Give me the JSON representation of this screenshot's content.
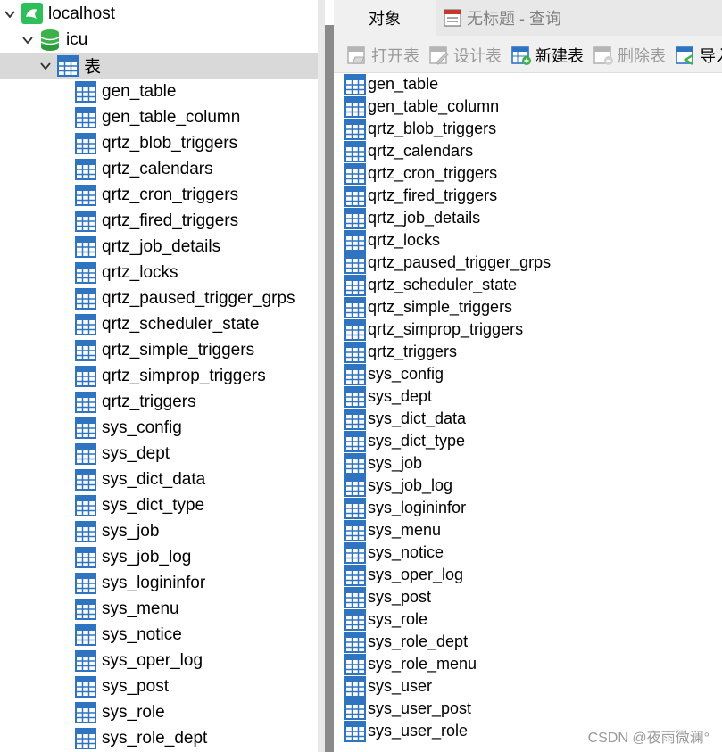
{
  "tree": {
    "connection": "localhost",
    "database": "icu",
    "tables_node": "表",
    "tables": [
      "gen_table",
      "gen_table_column",
      "qrtz_blob_triggers",
      "qrtz_calendars",
      "qrtz_cron_triggers",
      "qrtz_fired_triggers",
      "qrtz_job_details",
      "qrtz_locks",
      "qrtz_paused_trigger_grps",
      "qrtz_scheduler_state",
      "qrtz_simple_triggers",
      "qrtz_simprop_triggers",
      "qrtz_triggers",
      "sys_config",
      "sys_dept",
      "sys_dict_data",
      "sys_dict_type",
      "sys_job",
      "sys_job_log",
      "sys_logininfor",
      "sys_menu",
      "sys_notice",
      "sys_oper_log",
      "sys_post",
      "sys_role",
      "sys_role_dept"
    ]
  },
  "tabs": {
    "objects": "对象",
    "query": "无标题 - 查询"
  },
  "toolbar": {
    "open": "打开表",
    "design": "设计表",
    "new": "新建表",
    "delete": "删除表",
    "import": "导入"
  },
  "objects": [
    "gen_table",
    "gen_table_column",
    "qrtz_blob_triggers",
    "qrtz_calendars",
    "qrtz_cron_triggers",
    "qrtz_fired_triggers",
    "qrtz_job_details",
    "qrtz_locks",
    "qrtz_paused_trigger_grps",
    "qrtz_scheduler_state",
    "qrtz_simple_triggers",
    "qrtz_simprop_triggers",
    "qrtz_triggers",
    "sys_config",
    "sys_dept",
    "sys_dict_data",
    "sys_dict_type",
    "sys_job",
    "sys_job_log",
    "sys_logininfor",
    "sys_menu",
    "sys_notice",
    "sys_oper_log",
    "sys_post",
    "sys_role",
    "sys_role_dept",
    "sys_role_menu",
    "sys_user",
    "sys_user_post",
    "sys_user_role"
  ],
  "watermark": "CSDN @夜雨微澜°",
  "colors": {
    "selected_row": "#d9d9d9",
    "table_icon": "#2f74c0",
    "db_icon": "#3bb34a",
    "connection_icon": "#2fbf5a"
  }
}
